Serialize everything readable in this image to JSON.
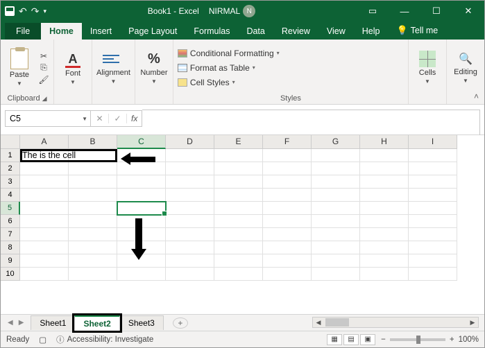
{
  "titlebar": {
    "doc_title": "Book1 - Excel",
    "user_name": "NIRMAL",
    "avatar_initial": "N"
  },
  "tabs": {
    "file": "File",
    "home": "Home",
    "insert": "Insert",
    "page_layout": "Page Layout",
    "formulas": "Formulas",
    "data": "Data",
    "review": "Review",
    "view": "View",
    "help": "Help",
    "tell_me": "Tell me"
  },
  "ribbon": {
    "clipboard": {
      "label": "Clipboard",
      "paste": "Paste"
    },
    "font": {
      "label": "Font"
    },
    "alignment": {
      "label": "Alignment"
    },
    "number": {
      "label": "Number"
    },
    "styles": {
      "label": "Styles",
      "conditional_formatting": "Conditional Formatting",
      "format_as_table": "Format as Table",
      "cell_styles": "Cell Styles"
    },
    "cells": {
      "label": "Cells"
    },
    "editing": {
      "label": "Editing"
    }
  },
  "namebox": {
    "value": "C5"
  },
  "fx_label": "fx",
  "columns": [
    "A",
    "B",
    "C",
    "D",
    "E",
    "F",
    "G",
    "H",
    "I"
  ],
  "rows": [
    1,
    2,
    3,
    4,
    5,
    6,
    7,
    8,
    9,
    10
  ],
  "active_col_index": 2,
  "active_row_index": 4,
  "cell_a1_text": "The is the cell",
  "sheets": {
    "sheet1": "Sheet1",
    "sheet2": "Sheet2",
    "sheet3": "Sheet3"
  },
  "status": {
    "ready": "Ready",
    "accessibility": "Accessibility: Investigate",
    "zoom": "100%"
  }
}
